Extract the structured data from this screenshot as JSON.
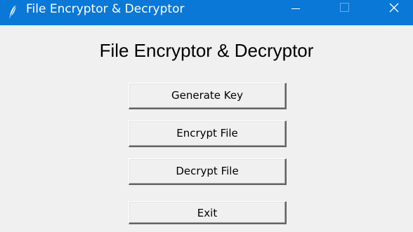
{
  "window": {
    "title": "File Encryptor & Decryptor",
    "app_icon": "feather-icon",
    "controls": [
      "minimize-icon",
      "maximize-icon",
      "close-icon"
    ],
    "titlebar_color": "#0a78d7"
  },
  "main": {
    "heading": "File Encryptor & Decryptor",
    "buttons": {
      "generate_key": "Generate Key",
      "encrypt_file": "Encrypt File",
      "decrypt_file": "Decrypt File",
      "exit": "Exit"
    }
  }
}
